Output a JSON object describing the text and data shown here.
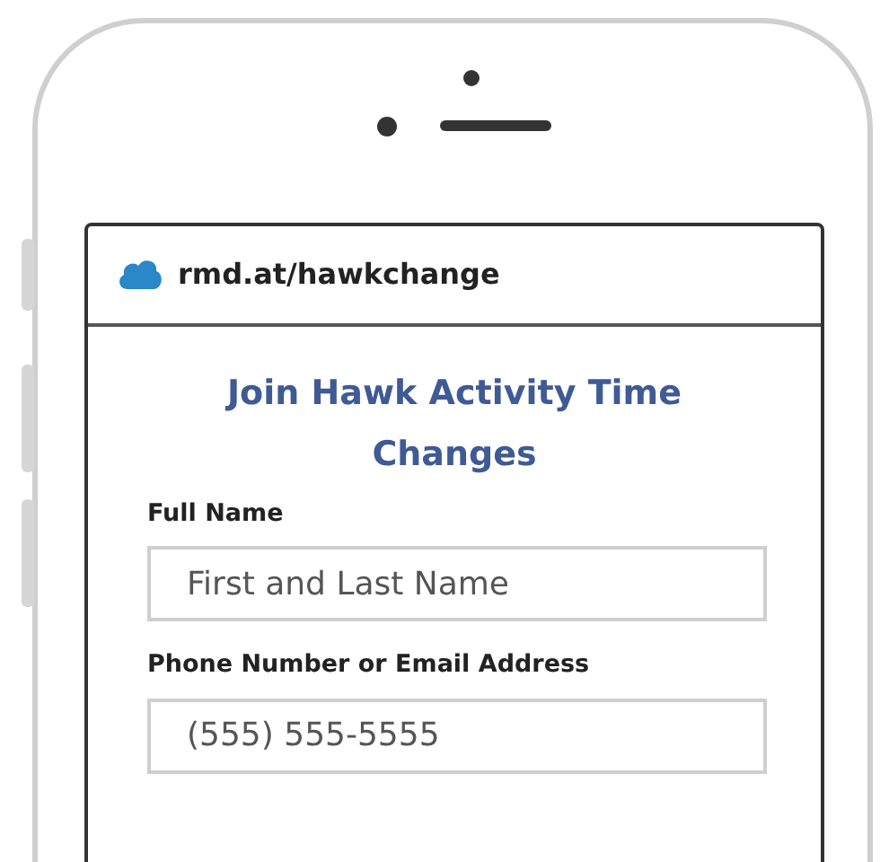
{
  "browser": {
    "url": "rmd.at/hawkchange"
  },
  "form": {
    "title": "Join Hawk Activity Time Changes",
    "fields": [
      {
        "label": "Full Name",
        "placeholder": "First and Last Name"
      },
      {
        "label": "Phone Number or Email Address",
        "placeholder": "(555) 555-5555"
      }
    ]
  }
}
